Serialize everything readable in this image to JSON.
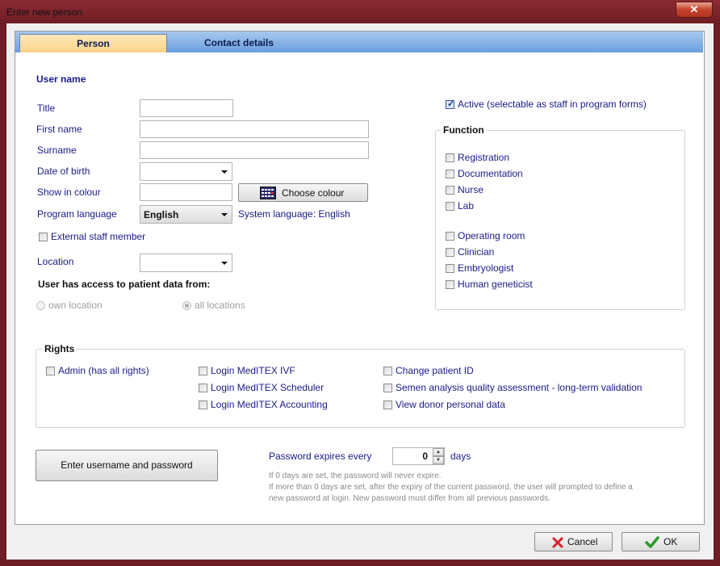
{
  "window": {
    "title": "Enter new person",
    "close_glyph": "✕"
  },
  "tabs": [
    {
      "label": "Person"
    },
    {
      "label": "Contact details"
    }
  ],
  "user_name": {
    "heading": "User name",
    "title_label": "Title",
    "first_name_label": "First name",
    "surname_label": "Surname",
    "dob_label": "Date of birth",
    "colour_label": "Show in colour",
    "choose_colour_button": "Choose colour",
    "language_label": "Program language",
    "language_value": "English",
    "system_language": "System language: English",
    "external_staff": "External staff member",
    "location_label": "Location",
    "access_heading": "User has access to patient data from:",
    "own_location": "own location",
    "all_locations": "all locations"
  },
  "active_label": "Active (selectable as staff in program forms)",
  "function": {
    "legend": "Function",
    "items": [
      "Registration",
      "Documentation",
      "Nurse",
      "Lab",
      "Operating room",
      "Clinician",
      "Embryologist",
      "Human geneticist"
    ]
  },
  "rights": {
    "legend": "Rights",
    "admin": "Admin (has all rights)",
    "col2": [
      "Login MedITEX IVF",
      "Login MedITEX Scheduler",
      "Login MedITEX Accounting"
    ],
    "col3": [
      "Change patient ID",
      "Semen analysis quality assessment -  long-term validation",
      "View donor personal data"
    ]
  },
  "credentials_button": "Enter username and password",
  "password": {
    "label": "Password expires every",
    "value": "0",
    "unit": "days",
    "note1": "If 0 days are set, the password will never expire.",
    "note2": "If more than 0 days are set, after the expiry of the current password, the user will prompted to define a",
    "note3": "new password at login. New password must differ from all previous passwords."
  },
  "footer": {
    "cancel": "Cancel",
    "ok": "OK"
  },
  "colors": {
    "label_blue": "#1a1a8a",
    "tab_active": "#f8d48a",
    "tab_bar": "#6aa0dc",
    "frame": "#7a1f27"
  },
  "icons": [
    "close-icon",
    "calendar-grid-icon",
    "cross-icon",
    "check-icon",
    "chevron-down-icon"
  ]
}
